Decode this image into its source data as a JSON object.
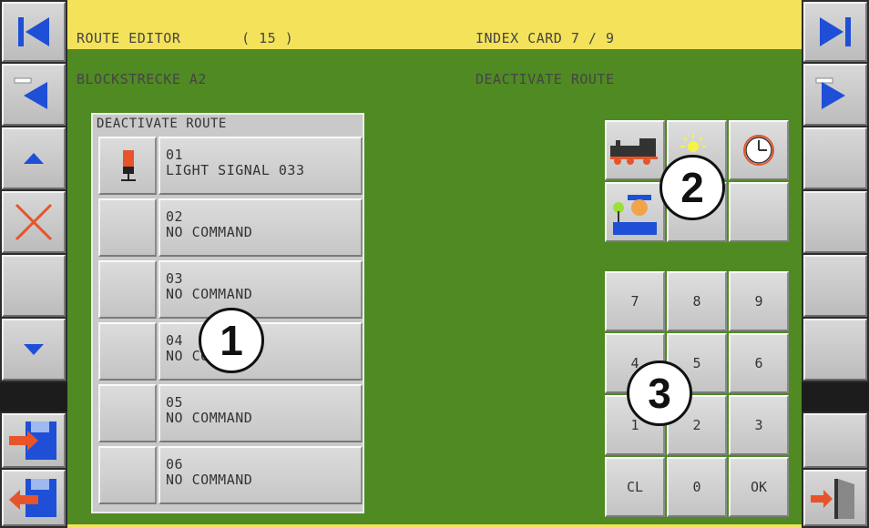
{
  "header": {
    "left_line1": "ROUTE EDITOR       ( 15 )",
    "left_line2": "BLOCKSTRECKE A2",
    "right_line1": "INDEX CARD 7 / 9",
    "right_line2": "DEACTIVATE ROUTE"
  },
  "panel": {
    "title": "DEACTIVATE ROUTE",
    "rows": [
      {
        "number": "01",
        "command": "LIGHT SIGNAL 033",
        "icon": "light-signal-icon"
      },
      {
        "number": "02",
        "command": "NO COMMAND",
        "icon": ""
      },
      {
        "number": "03",
        "command": "NO COMMAND",
        "icon": ""
      },
      {
        "number": "04",
        "command": "NO COMMAND",
        "icon": ""
      },
      {
        "number": "05",
        "command": "NO COMMAND",
        "icon": ""
      },
      {
        "number": "06",
        "command": "NO COMMAND",
        "icon": ""
      }
    ]
  },
  "category_buttons": [
    "locomotive-icon",
    "light-icon",
    "clock-icon",
    "person-signal-icon",
    "",
    ""
  ],
  "keypad": {
    "keys": [
      "7",
      "8",
      "9",
      "4",
      "5",
      "6",
      "1",
      "2",
      "3",
      "CL",
      "0",
      "OK"
    ]
  },
  "callouts": [
    "1",
    "2",
    "3"
  ],
  "left_sidebar": [
    "first-page-icon",
    "previous-page-icon",
    "scroll-up-icon",
    "delete-icon",
    "",
    "scroll-down-icon",
    "save-import-icon",
    "save-export-icon"
  ],
  "right_sidebar": [
    "last-page-icon",
    "next-page-icon",
    "",
    "",
    "",
    "",
    "",
    "exit-icon"
  ],
  "colors": {
    "background": "#4f8a23",
    "header": "#f4e25a",
    "button": "#cfcfcf",
    "accent_blue": "#1e4fd6",
    "accent_red": "#e8542a"
  }
}
